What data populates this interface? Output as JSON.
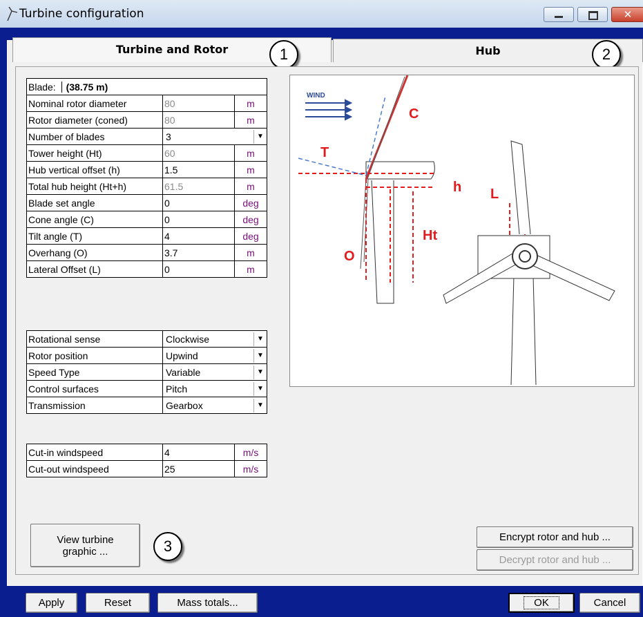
{
  "window": {
    "title": "Turbine configuration"
  },
  "tabs": [
    {
      "label": "Turbine and Rotor"
    },
    {
      "label": "Hub"
    }
  ],
  "callouts": [
    "1",
    "2",
    "3"
  ],
  "blade": {
    "label": "Blade:",
    "value": "(38.75 m)"
  },
  "params": [
    {
      "label": "Nominal rotor diameter",
      "value": "80",
      "unit": "m",
      "readonly": true
    },
    {
      "label": "Rotor diameter (coned)",
      "value": "80",
      "unit": "m",
      "readonly": true
    },
    {
      "label": "Tower height (Ht)",
      "value": "60",
      "unit": "m",
      "readonly": true
    },
    {
      "label": "Hub vertical offset (h)",
      "value": "1.5",
      "unit": "m",
      "readonly": false
    },
    {
      "label": "Total hub height (Ht+h)",
      "value": "61.5",
      "unit": "m",
      "readonly": true
    },
    {
      "label": "Blade set angle",
      "value": "0",
      "unit": "deg",
      "readonly": false
    },
    {
      "label": "Cone angle (C)",
      "value": "0",
      "unit": "deg",
      "readonly": false
    },
    {
      "label": "Tilt angle (T)",
      "value": "4",
      "unit": "deg",
      "readonly": false
    },
    {
      "label": "Overhang (O)",
      "value": "3.7",
      "unit": "m",
      "readonly": false
    },
    {
      "label": "Lateral Offset (L)",
      "value": "0",
      "unit": "m",
      "readonly": false
    }
  ],
  "blades_row": {
    "label": "Number of blades",
    "value": "3"
  },
  "options": [
    {
      "label": "Rotational sense",
      "value": "Clockwise"
    },
    {
      "label": "Rotor position",
      "value": "Upwind"
    },
    {
      "label": "Speed Type",
      "value": "Variable"
    },
    {
      "label": "Control surfaces",
      "value": "Pitch"
    },
    {
      "label": "Transmission",
      "value": "Gearbox"
    }
  ],
  "windspeeds": [
    {
      "label": "Cut-in windspeed",
      "value": "4",
      "unit": "m/s"
    },
    {
      "label": "Cut-out windspeed",
      "value": "25",
      "unit": "m/s"
    }
  ],
  "diagram": {
    "wind": "WIND",
    "c": "C",
    "t": "T",
    "h": "h",
    "l": "L",
    "ht": "Ht",
    "o": "O"
  },
  "buttons": {
    "view_graphic_1": "View turbine",
    "view_graphic_2": "graphic ...",
    "encrypt": "Encrypt rotor and hub ...",
    "decrypt": "Decrypt rotor and hub ...",
    "apply": "Apply",
    "reset": "Reset",
    "mass": "Mass totals...",
    "ok": "OK",
    "cancel": "Cancel"
  }
}
